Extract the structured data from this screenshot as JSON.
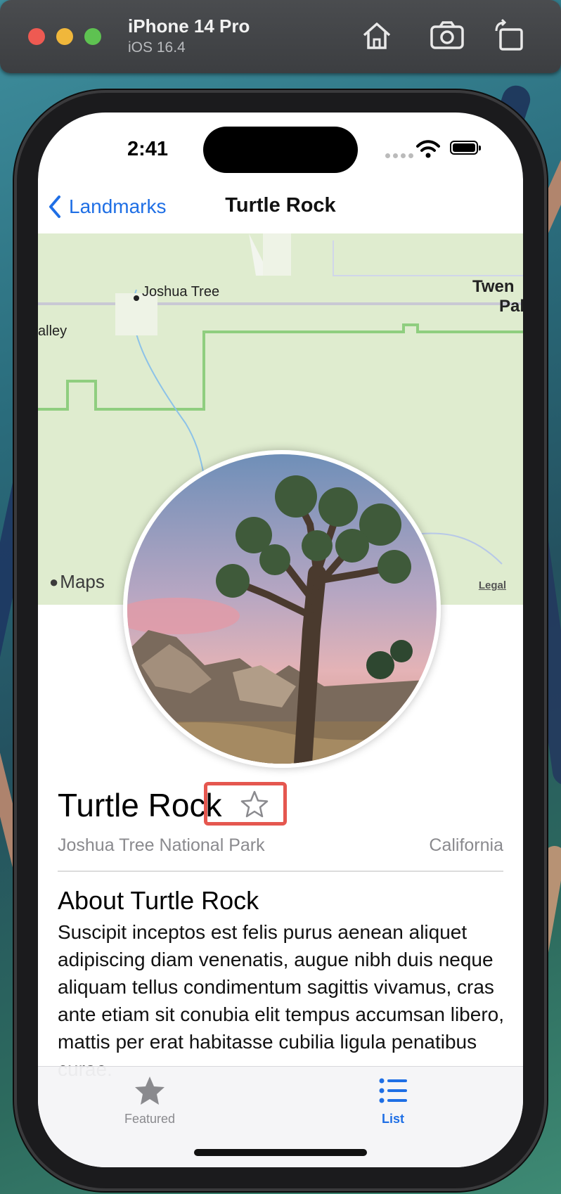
{
  "simulator": {
    "device_name": "iPhone 14 Pro",
    "os_version": "iOS 16.4",
    "buttons": [
      "home-icon",
      "screenshot-icon",
      "rotate-icon"
    ]
  },
  "status_bar": {
    "time": "2:41"
  },
  "nav": {
    "back_label": "Landmarks",
    "title": "Turtle Rock"
  },
  "map": {
    "labels": {
      "joshua_tree": "Joshua Tree",
      "valley": "alley",
      "twentynine_1": "Twen",
      "twentynine_2": "Pal"
    },
    "attribution": "Maps",
    "legal": "Legal"
  },
  "landmark": {
    "name": "Turtle Rock",
    "is_favorite": false,
    "park": "Joshua Tree National Park",
    "state": "California"
  },
  "about": {
    "heading": "About Turtle Rock",
    "text": "Suscipit inceptos est felis purus aenean aliquet adipiscing diam venenatis, augue nibh duis neque aliquam tellus condimentum sagittis vivamus, cras ante etiam sit conubia elit tempus accumsan libero, mattis per erat habitasse cubilia ligula penatibus curae."
  },
  "tabs": [
    {
      "label": "Featured",
      "icon": "star-icon",
      "selected": false
    },
    {
      "label": "List",
      "icon": "list-icon",
      "selected": true
    }
  ],
  "colors": {
    "accent": "#1f6fe5",
    "highlight": "#e5574f",
    "inactive_tab": "#8a8a8e"
  }
}
